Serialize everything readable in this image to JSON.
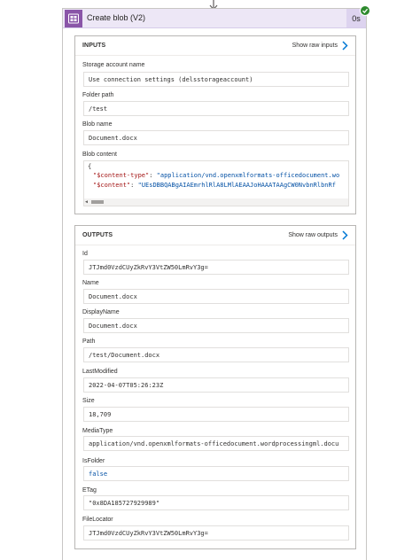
{
  "card": {
    "title": "Create blob (V2)",
    "duration": "0s",
    "status": "succeeded",
    "icon": "blob-storage-icon",
    "accent": "#8a55a8"
  },
  "inputs": {
    "title": "INPUTS",
    "raw_link": "Show raw inputs",
    "fields": [
      {
        "label": "Storage account name",
        "value": "Use connection settings (delsstorageaccount)"
      },
      {
        "label": "Folder path",
        "value": "/test"
      },
      {
        "label": "Blob name",
        "value": "Document.docx"
      }
    ],
    "blob_content": {
      "label": "Blob content",
      "open_brace": "{",
      "line1_key": "\"$content-type\"",
      "line1_value": "\"application/vnd.openxmlformats-officedocument.wo",
      "line2_key": "\"$content\"",
      "line2_value": "\"UEsDBBQABgAIAEmrhlRlA8LMlAEAAJoHAAATAAgCW0NvbnRlbnRf"
    }
  },
  "outputs": {
    "title": "OUTPUTS",
    "raw_link": "Show raw outputs",
    "fields": [
      {
        "label": "Id",
        "value": "JTJmd0VzdCUyZkRvY3VtZW50LmRvY3g="
      },
      {
        "label": "Name",
        "value": "Document.docx"
      },
      {
        "label": "DisplayName",
        "value": "Document.docx"
      },
      {
        "label": "Path",
        "value": "/test/Document.docx"
      },
      {
        "label": "LastModified",
        "value": "2022-04-07T05:26:23Z"
      },
      {
        "label": "Size",
        "value": "18,709"
      },
      {
        "label": "MediaType",
        "value": "application/vnd.openxmlformats-officedocument.wordprocessingml.docu"
      },
      {
        "label": "IsFolder",
        "value": "false"
      },
      {
        "label": "ETag",
        "value": "\"0x8DA185727929989\""
      },
      {
        "label": "FileLocator",
        "value": "JTJmd0VzdCUyZkRvY3VtZW50LmRvY3g="
      }
    ]
  }
}
